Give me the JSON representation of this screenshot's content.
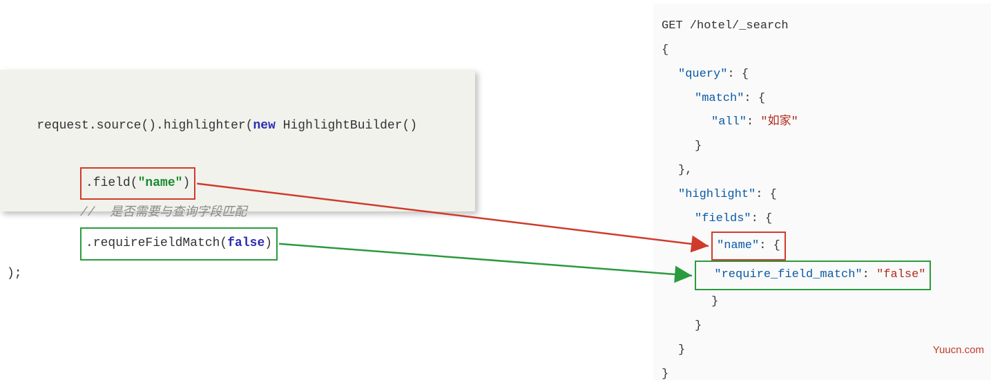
{
  "left": {
    "line1_prefix": "request.source().highlighter(",
    "line1_new": "new",
    "line1_suffix": " HighlightBuilder()",
    "field_call_prefix": ".field(",
    "field_arg": "\"name\"",
    "field_call_suffix": ")",
    "comment": "//  是否需要与查询字段匹配",
    "rfm_call_prefix": ".requireFieldMatch(",
    "rfm_arg": "false",
    "rfm_call_suffix": ")",
    "closing": ");"
  },
  "right": {
    "line_get": "GET /hotel/_search",
    "open_brace": "{",
    "query_key": "\"query\"",
    "match_key": "\"match\"",
    "all_key": "\"all\"",
    "all_val": "\"如家\"",
    "close_brace": "}",
    "close_brace_comma": "},",
    "highlight_key": "\"highlight\"",
    "fields_key": "\"fields\"",
    "name_key": "\"name\"",
    "rfm_key": "\"require_field_match\"",
    "rfm_val": "\"false\"",
    "colon_open": ": {",
    "colon_sp": ": "
  },
  "watermark": "Yuucn.com"
}
